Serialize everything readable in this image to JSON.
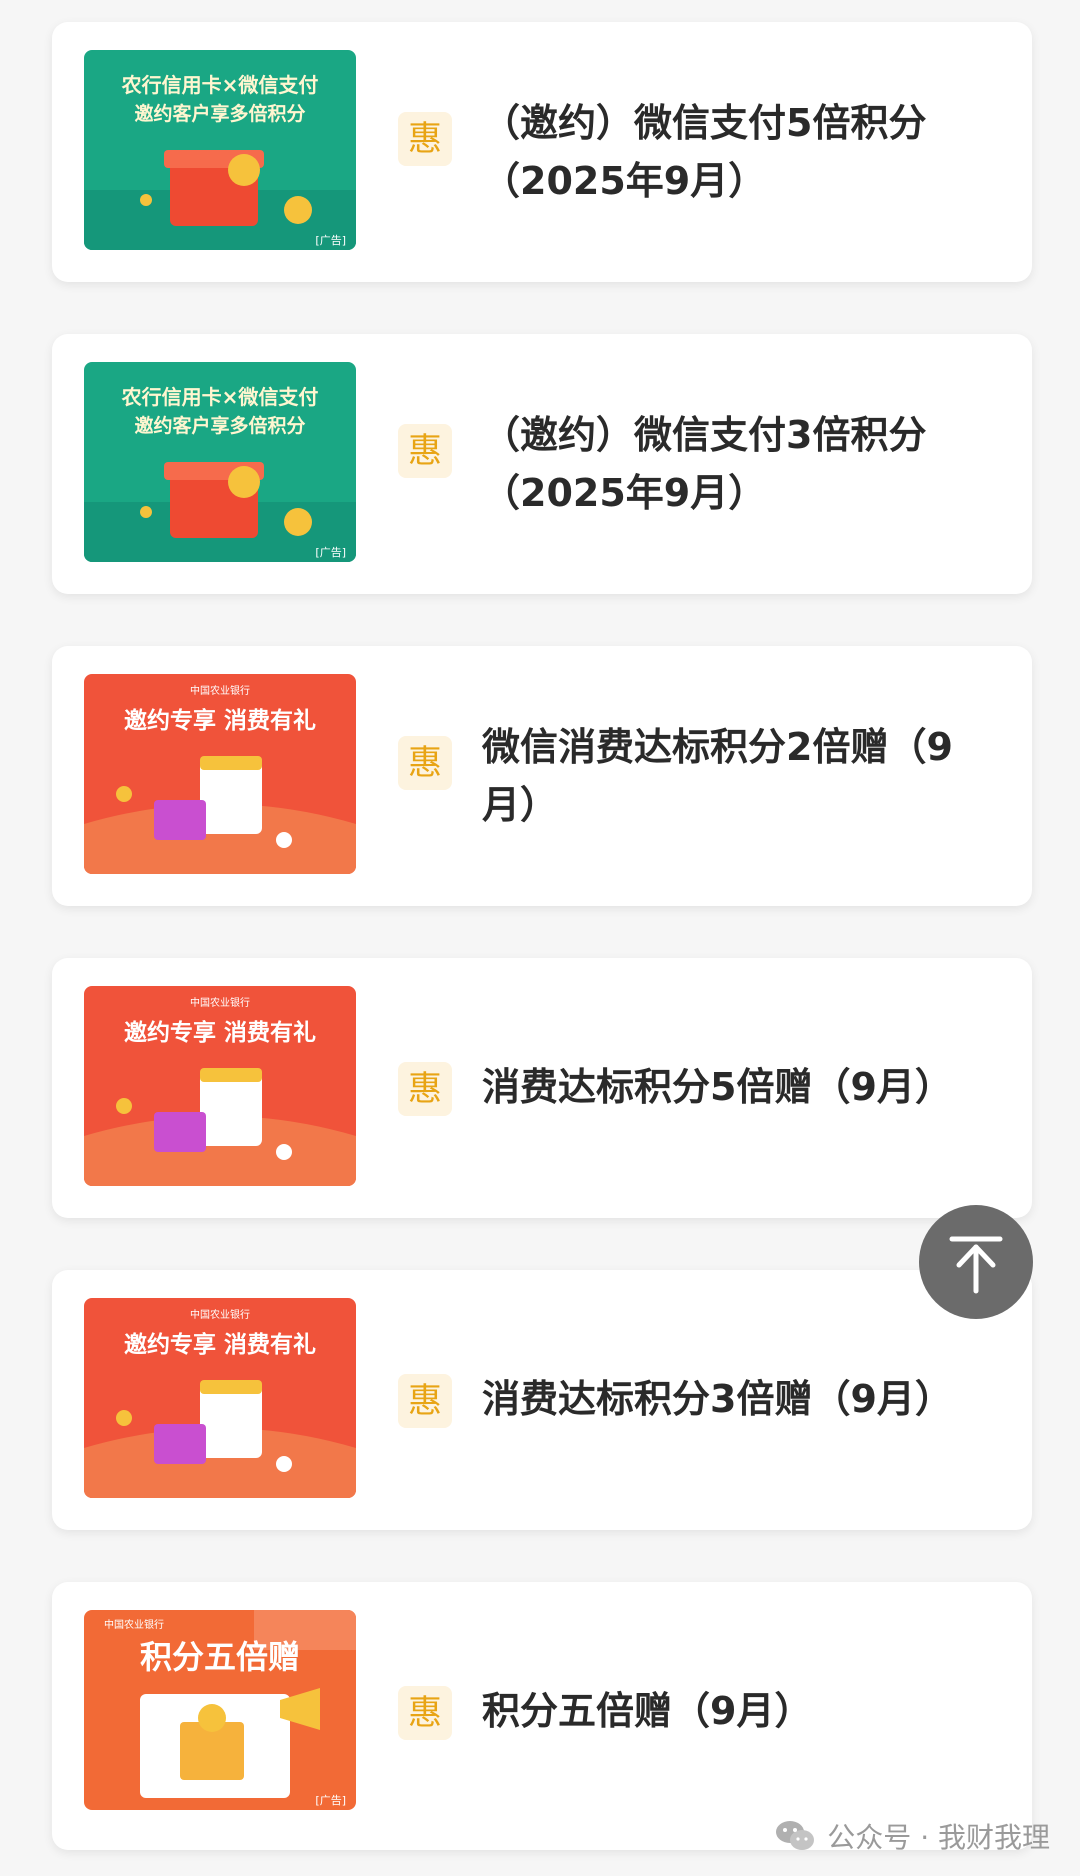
{
  "badge_char": "惠",
  "promos": [
    {
      "title": "（邀约）微信支付5倍积分（2025年9月）",
      "banner": {
        "theme": "green",
        "line1": "农行信用卡×微信支付",
        "line2": "邀约客户享多倍积分",
        "tag": "[广告]"
      }
    },
    {
      "title": "（邀约）微信支付3倍积分（2025年9月）",
      "banner": {
        "theme": "green",
        "line1": "农行信用卡×微信支付",
        "line2": "邀约客户享多倍积分",
        "tag": "[广告]"
      }
    },
    {
      "title": "微信消费达标积分2倍赠（9月）",
      "banner": {
        "theme": "red",
        "line1": "中国农业银行",
        "line2": "邀约专享 消费有礼"
      }
    },
    {
      "title": "消费达标积分5倍赠（9月）",
      "banner": {
        "theme": "red",
        "line1": "中国农业银行",
        "line2": "邀约专享 消费有礼"
      }
    },
    {
      "title": "消费达标积分3倍赠（9月）",
      "banner": {
        "theme": "red",
        "line1": "中国农业银行",
        "line2": "邀约专享 消费有礼"
      }
    },
    {
      "title": "积分五倍赠（9月）",
      "banner": {
        "theme": "orange",
        "line1": "中国农业银行",
        "line2": "积分五倍赠",
        "tag": "[广告]"
      }
    }
  ],
  "watermark": {
    "text": "公众号 · 我财我理",
    "icon": "wechat-icon"
  },
  "colors": {
    "accent": "#e8a414",
    "badge_bg": "#fdf3df",
    "green_banner": "#1aa784",
    "red_banner": "#f0533a",
    "back_top": "#6b6b6b"
  }
}
